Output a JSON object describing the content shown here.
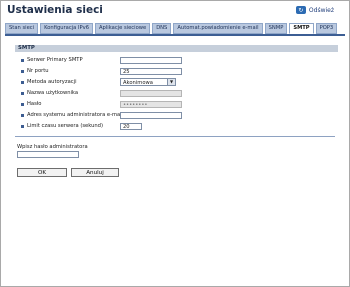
{
  "header": {
    "title": "Ustawienia sieci",
    "refresh_label": "Odśwież",
    "refresh_icon": "refresh-icon"
  },
  "tabs": [
    {
      "label": "Stan sieci"
    },
    {
      "label": "Konfiguracja IPv6"
    },
    {
      "label": "Aplikacje sieciowe"
    },
    {
      "label": "DNS"
    },
    {
      "label": "Automat.powiadomienie e-mail"
    },
    {
      "label": "SNMP"
    },
    {
      "label": "SMTP",
      "active": true
    },
    {
      "label": "POP3"
    }
  ],
  "smtp": {
    "section_title": "SMTP",
    "fields": {
      "server_label": "Serwer Primary SMTP",
      "server_value": "",
      "port_label": "Nr portu",
      "port_value": "25",
      "auth_label": "Metoda autoryzacji",
      "auth_value": "Akonimowa",
      "username_label": "Nazwa użytkownika",
      "username_value": "",
      "password_label": "Hasło",
      "password_value": "••••••••",
      "admin_email_label": "Adres systemu administratora e-mail",
      "admin_email_value": "",
      "timeout_label": "Limit czasu serwera (sekund)",
      "timeout_value": "20"
    }
  },
  "admin": {
    "password_label": "Wpisz hasło administratora",
    "password_value": ""
  },
  "buttons": {
    "ok": "OK",
    "cancel": "Anuluj"
  },
  "colors": {
    "tab_bg": "#b9c8df",
    "tab_active_bg": "#ffffff",
    "tab_underline": "#3c5e94",
    "section_bg": "#c6cfdb",
    "disabled_field": "#e4e4e4"
  }
}
